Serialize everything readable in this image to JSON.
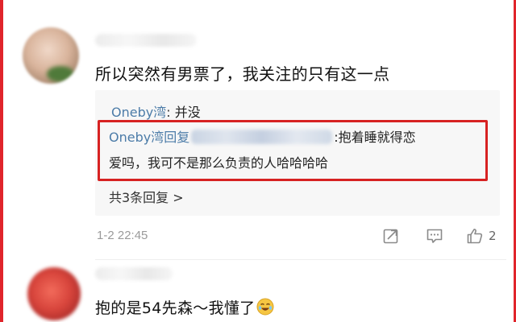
{
  "comment_1": {
    "text": "所以突然有男票了，我关注的只有这一点",
    "reply_summary": {
      "author": "Oneby湾",
      "separator": ": ",
      "text": "并没"
    },
    "highlighted_reply": {
      "author_prefix": "Oneby湾回复",
      "body_line_1": ":抱着睡就得恋",
      "body_line_2": "爱吗，我可不是那么负责的人哈哈哈哈"
    },
    "more_replies": "共3条回复 >",
    "timestamp": "1-2 22:45",
    "like_count": "2"
  },
  "comment_2": {
    "text": "抱的是54先森～我懂了",
    "emoji_icon": "laughing-face-icon"
  },
  "colors": {
    "frame": "#e0242b",
    "highlight_border": "#d72222",
    "author_link": "#4c7ca8",
    "reply_box_bg": "#f7f7f7"
  },
  "icons": {
    "share": "share-icon",
    "comment": "comment-icon",
    "like": "thumbs-up-icon"
  }
}
